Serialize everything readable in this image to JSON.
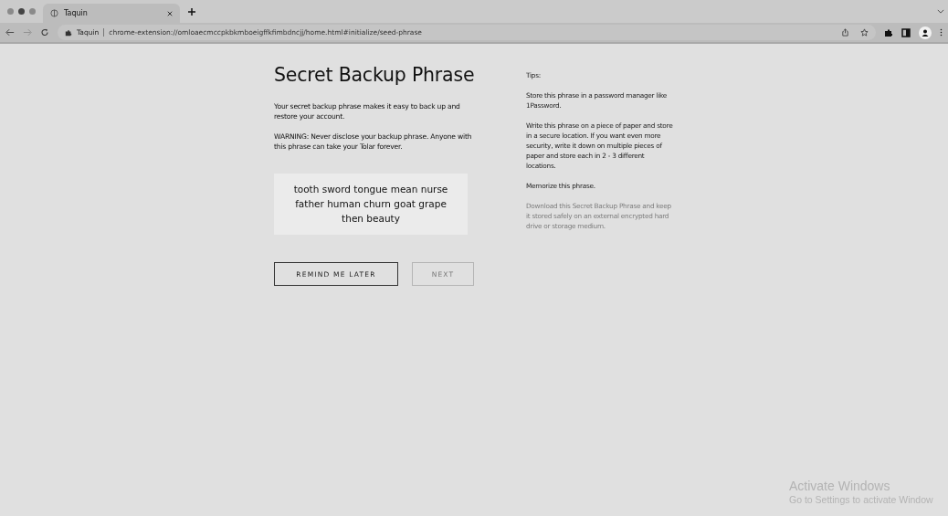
{
  "browser": {
    "tabs": [
      {
        "title": "Taquin",
        "selected": true
      }
    ],
    "address": {
      "site": "Taquin",
      "url": "chrome-extension://omloaecmccpkbkmboeigffkfimbdncjj/home.html#initialize/seed-phrase"
    }
  },
  "page": {
    "title": "Secret Backup Phrase",
    "paragraphs": [
      "Your secret backup phrase makes it easy to back up and restore your account.",
      "WARNING: Never disclose your backup phrase. Anyone with this phrase can take your Tolar forever."
    ],
    "seed_phrase": "tooth sword tongue mean nurse father human churn goat grape then beauty",
    "buttons": [
      {
        "label": "REMIND ME LATER",
        "disabled": false
      },
      {
        "label": "NEXT",
        "disabled": true
      }
    ],
    "tips_heading": "Tips:",
    "tips": [
      {
        "text": "Store this phrase in a password manager like 1Password.",
        "disabled": false
      },
      {
        "text": "Write this phrase on a piece of paper and store in a secure location. If you want even more security, write it down on multiple pieces of paper and store each in 2 - 3 different locations.",
        "disabled": false
      },
      {
        "text": "Memorize this phrase.",
        "disabled": false
      },
      {
        "text": "Download this Secret Backup Phrase and keep it stored safely on an external encrypted hard drive or storage medium.",
        "disabled": true
      }
    ]
  },
  "os_notice": {
    "title": "Activate Windows",
    "subtitle": "Go to Settings to activate Window"
  }
}
